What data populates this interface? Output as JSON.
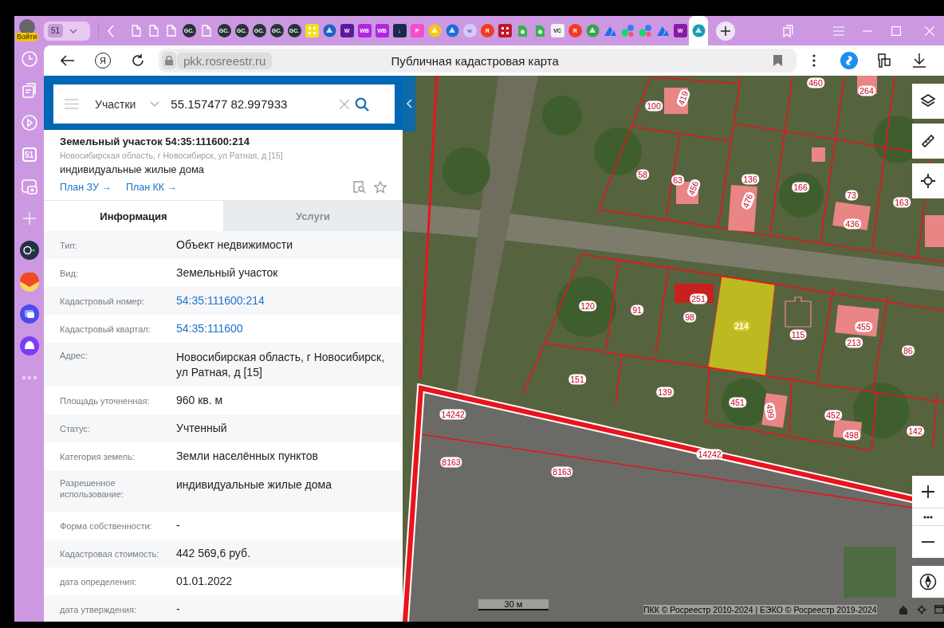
{
  "browser": {
    "login_badge": "Войти",
    "tab_group": "51",
    "tabs": [
      {
        "kind": "doc",
        "selected": false
      },
      {
        "kind": "doc",
        "selected": false
      },
      {
        "kind": "doc",
        "selected": false
      },
      {
        "kind": "round",
        "glyph": "GC.",
        "color": "#263238",
        "selected": false
      },
      {
        "kind": "doc",
        "selected": false
      },
      {
        "kind": "round",
        "glyph": "GC.",
        "color": "#263238",
        "selected": false
      },
      {
        "kind": "round",
        "glyph": "GC.",
        "color": "#263238",
        "selected": false
      },
      {
        "kind": "round",
        "glyph": "GC.",
        "color": "#263238",
        "selected": false
      },
      {
        "kind": "round",
        "glyph": "GC.",
        "color": "#263238",
        "selected": false
      },
      {
        "kind": "round",
        "glyph": "GC.",
        "color": "#263238",
        "selected": false
      },
      {
        "kind": "scan",
        "color": "#f2e21c",
        "selected": false
      },
      {
        "kind": "blob",
        "color": "#1e63c6",
        "selected": false
      },
      {
        "kind": "square",
        "glyph": "W",
        "color": "#5b1a9e",
        "selected": false
      },
      {
        "kind": "square",
        "glyph": "WB",
        "color": "#b026e0",
        "selected": false
      },
      {
        "kind": "square",
        "glyph": "WB",
        "color": "#b026e0",
        "selected": false
      },
      {
        "kind": "square",
        "glyph": "↓",
        "color": "#1b2a4a",
        "selected": false
      },
      {
        "kind": "square",
        "glyph": "P",
        "color": "#f04fd0",
        "selected": false
      },
      {
        "kind": "blob",
        "color": "#f5c518",
        "selected": false
      },
      {
        "kind": "blob",
        "color": "#1a6fd6",
        "selected": false
      },
      {
        "kind": "round",
        "glyph": "w",
        "color": "#d7c8f5",
        "selected": false
      },
      {
        "kind": "round",
        "glyph": "Я",
        "color": "#f33a24",
        "selected": false
      },
      {
        "kind": "scan",
        "color": "#c0182a",
        "selected": false
      },
      {
        "kind": "docfill",
        "color": "#35b548",
        "selected": false
      },
      {
        "kind": "docfill",
        "color": "#35b548",
        "selected": false
      },
      {
        "kind": "square",
        "glyph": "VC",
        "color": "#f2f2f2",
        "selected": false
      },
      {
        "kind": "round",
        "glyph": "Я",
        "color": "#f33a24",
        "selected": false
      },
      {
        "kind": "blob",
        "color": "#3aa34a",
        "selected": false
      },
      {
        "kind": "arrow",
        "color": "#1d6ef2",
        "selected": false
      },
      {
        "kind": "dots",
        "color": "#1fd26b",
        "selected": false
      },
      {
        "kind": "dots",
        "color": "#1fd26b",
        "selected": false
      },
      {
        "kind": "arrow",
        "color": "#1d6ef2",
        "selected": false
      },
      {
        "kind": "square",
        "glyph": "W",
        "color": "#8a1aa8",
        "selected": false
      },
      {
        "kind": "blob",
        "color": "#1b9bb8",
        "selected": true
      }
    ],
    "yandex_button": "Я",
    "url": "pkk.rosreestr.ru",
    "page_title": "Публичная кадастровая карта",
    "sidebar": [
      {
        "kind": "history"
      },
      {
        "kind": "collections"
      },
      {
        "kind": "play"
      },
      {
        "kind": "counter",
        "glyph": "51"
      },
      {
        "kind": "screenshot"
      },
      {
        "kind": "add"
      },
      {
        "kind": "alice-dark"
      },
      {
        "kind": "mail"
      },
      {
        "kind": "messenger"
      },
      {
        "kind": "alice"
      },
      {
        "kind": "more"
      }
    ]
  },
  "search": {
    "category": "Участки",
    "value": "55.157477 82.997933"
  },
  "card": {
    "title": "Земельный участок 54:35:111600:214",
    "address": "Новосибирская область, г Новосибирск, ул Ратная, д [15]",
    "purpose": "индивидуальные жилые дома",
    "links": [
      "План ЗУ →",
      "План КК →"
    ]
  },
  "tabs": [
    {
      "label": "Информация",
      "selected": true
    },
    {
      "label": "Услуги",
      "selected": false
    }
  ],
  "rows": [
    {
      "label": "Тип:",
      "value": "Объект недвижимости",
      "kind": "text"
    },
    {
      "label": "Вид:",
      "value": "Земельный участок",
      "kind": "text"
    },
    {
      "label": "Кадастровый номер:",
      "value": "54:35:111600:214",
      "kind": "link"
    },
    {
      "label": "Кадастровый квартал:",
      "value": "54:35:111600",
      "kind": "link"
    },
    {
      "label": "Адрес:",
      "value": "Новосибирская область, г Новосибирск, ул Ратная, д [15]",
      "kind": "text"
    },
    {
      "label": "Площадь уточненная:",
      "value": "960 кв. м",
      "kind": "text"
    },
    {
      "label": "Статус:",
      "value": "Учтенный",
      "kind": "text"
    },
    {
      "label": "Категория земель:",
      "value": "Земли населённых пунктов",
      "kind": "text"
    },
    {
      "label": "Разрешенное использование:",
      "value": "индивидуальные жилые дома",
      "kind": "text"
    },
    {
      "label": "Форма собственности:",
      "value": "-",
      "kind": "text"
    },
    {
      "label": "Кадастровая стоимость:",
      "value": "442 569,6 руб.",
      "kind": "text"
    },
    {
      "label": "дата определения:",
      "value": "01.01.2022",
      "kind": "text"
    },
    {
      "label": "дата утверждения:",
      "value": "-",
      "kind": "text"
    }
  ],
  "map": {
    "parcel_labels": [
      {
        "text": "100",
        "selected": false
      },
      {
        "text": "419",
        "selected": false
      },
      {
        "text": "460",
        "selected": false
      },
      {
        "text": "264",
        "selected": false
      },
      {
        "text": "58",
        "selected": false
      },
      {
        "text": "63",
        "selected": false
      },
      {
        "text": "456",
        "selected": false
      },
      {
        "text": "136",
        "selected": false
      },
      {
        "text": "476",
        "selected": false
      },
      {
        "text": "166",
        "selected": false
      },
      {
        "text": "73",
        "selected": false
      },
      {
        "text": "436",
        "selected": false
      },
      {
        "text": "163",
        "selected": false
      },
      {
        "text": "120",
        "selected": false
      },
      {
        "text": "91",
        "selected": false
      },
      {
        "text": "251",
        "selected": false
      },
      {
        "text": "98",
        "selected": false
      },
      {
        "text": "214",
        "selected": true
      },
      {
        "text": "115",
        "selected": false
      },
      {
        "text": "455",
        "selected": false
      },
      {
        "text": "213",
        "selected": false
      },
      {
        "text": "86",
        "selected": false
      },
      {
        "text": "151",
        "selected": false
      },
      {
        "text": "139",
        "selected": false
      },
      {
        "text": "451",
        "selected": false
      },
      {
        "text": "499",
        "selected": false
      },
      {
        "text": "452",
        "selected": false
      },
      {
        "text": "498",
        "selected": false
      },
      {
        "text": "142",
        "selected": false
      },
      {
        "text": "14242",
        "selected": false
      },
      {
        "text": "14242",
        "selected": false
      },
      {
        "text": "8163",
        "selected": false
      },
      {
        "text": "8163",
        "selected": false
      }
    ],
    "scale": "30 м",
    "attribution": "ПКК © Росреестр 2010-2024 | ЕЭКО © Росреестр 2019-2024"
  }
}
